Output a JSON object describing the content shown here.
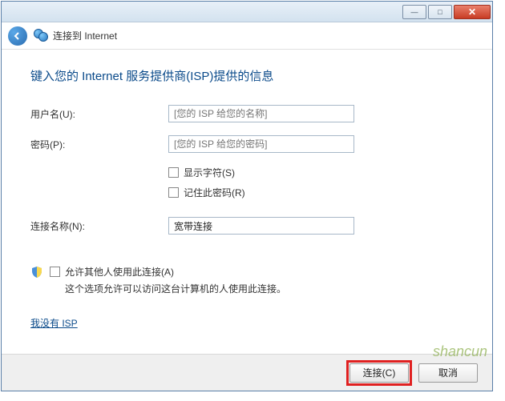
{
  "titlebar": {
    "min": "—",
    "max": "□",
    "close": "✕"
  },
  "header": {
    "title": "连接到 Internet"
  },
  "heading": "键入您的 Internet 服务提供商(ISP)提供的信息",
  "form": {
    "username_label": "用户名(U):",
    "username_placeholder": "[您的 ISP 给您的名称]",
    "password_label": "密码(P):",
    "password_placeholder": "[您的 ISP 给您的密码]",
    "show_chars": "显示字符(S)",
    "remember": "记住此密码(R)",
    "conn_name_label": "连接名称(N):",
    "conn_name_value": "宽带连接",
    "allow_others": "允许其他人使用此连接(A)",
    "allow_note": "这个选项允许可以访问这台计算机的人使用此连接。",
    "no_isp": "我没有 ISP"
  },
  "footer": {
    "connect": "连接(C)",
    "cancel": "取消"
  },
  "watermark": "shancun"
}
